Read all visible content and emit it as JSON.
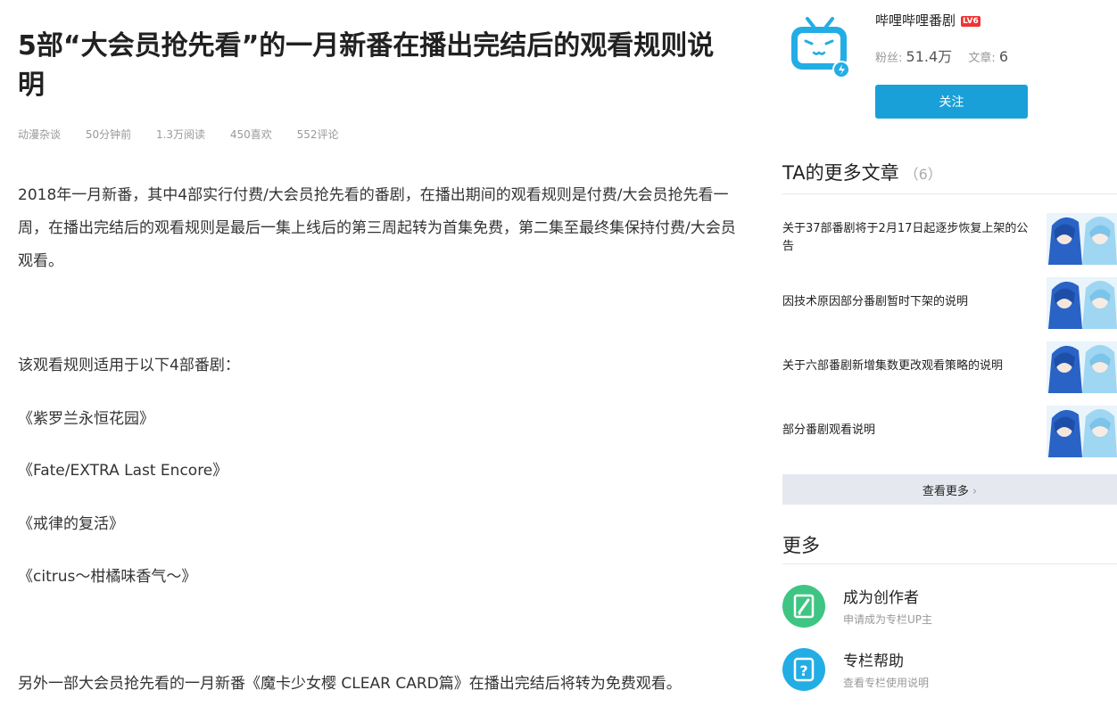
{
  "article": {
    "title": "5部“大会员抢先看”的一月新番在播出完结后的观看规则说明",
    "meta": {
      "category": "动漫杂谈",
      "time": "50分钟前",
      "reads": "1.3万阅读",
      "likes": "450喜欢",
      "comments": "552评论"
    },
    "paragraphs": [
      "2018年一月新番，其中4部实行付费/大会员抢先看的番剧，在播出期间的观看规则是付费/大会员抢先看一周，在播出完结后的观看规则是最后一集上线后的第三周起转为首集免费，第二集至最终集保持付费/大会员观看。",
      "该观看规则适用于以下4部番剧：",
      "《紫罗兰永恒花园》",
      "《Fate/EXTRA Last Encore》",
      "《戒律的复活》",
      "《citrus～柑橘味香气～》",
      "另外一部大会员抢先看的一月新番《魔卡少女樱 CLEAR CARD篇》在播出完结后将转为免费观看。"
    ]
  },
  "sidebar": {
    "up": {
      "name": "哔哩哔哩番剧",
      "level_badge": "LV6",
      "fans_label": "粉丝:",
      "fans_value": "51.4万",
      "articles_label": "文章:",
      "articles_value": "6",
      "follow_label": "关注"
    },
    "more_articles": {
      "title": "TA的更多文章",
      "count": "（6）",
      "items": [
        {
          "title": "关于37部番剧将于2月17日起逐步恢复上架的公告",
          "thumb_icon": "anime-characters-thumbnail"
        },
        {
          "title": "因技术原因部分番剧暂时下架的说明",
          "thumb_icon": "anime-characters-thumbnail"
        },
        {
          "title": "关于六部番剧新增集数更改观看策略的说明",
          "thumb_icon": "anime-characters-thumbnail"
        },
        {
          "title": "部分番剧观看说明",
          "thumb_icon": "anime-characters-thumbnail"
        }
      ],
      "view_more_label": "查看更多"
    },
    "more": {
      "title": "更多",
      "items": [
        {
          "title": "成为创作者",
          "subtitle": "申请成为专栏UP主",
          "icon": "pen-icon",
          "color": "#3ec583"
        },
        {
          "title": "专栏帮助",
          "subtitle": "查看专栏使用说明",
          "icon": "help-icon",
          "color": "#23ade5"
        }
      ]
    }
  },
  "colors": {
    "accent": "#1aa0d8",
    "divider": "#e5e9ef",
    "meta_text": "#999999",
    "badge_red": "#e33333"
  }
}
